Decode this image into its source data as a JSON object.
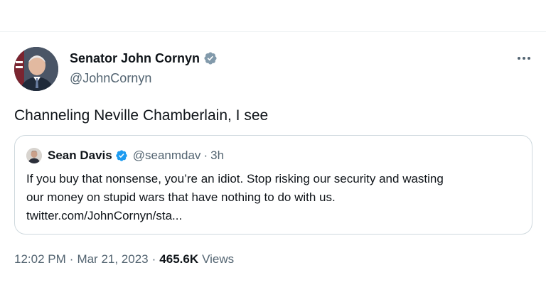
{
  "tweet": {
    "author_name": "Senator John Cornyn",
    "author_handle": "@JohnCornyn",
    "text": "Channeling Neville Chamberlain, I see",
    "time": "12:02 PM",
    "separator": "·",
    "date": "Mar 21, 2023",
    "views_count": "465.6K",
    "views_label": "Views"
  },
  "quoted_tweet": {
    "author_name": "Sean Davis",
    "author_handle": "@seanmdav",
    "separator": "·",
    "time_ago": "3h",
    "text_line1": "If you buy that nonsense, you’re an idiot. Stop risking our security and wasting",
    "text_line2": "our money on stupid wars that have nothing to do with us.",
    "text_line3": "twitter.com/JohnCornyn/sta..."
  },
  "colors": {
    "verified": "#1d9bf0",
    "text_primary": "#0f1419",
    "text_secondary": "#536471",
    "border": "#cfd9de"
  },
  "icons": {
    "verified": "verified-badge-icon",
    "more": "more-options-icon"
  }
}
